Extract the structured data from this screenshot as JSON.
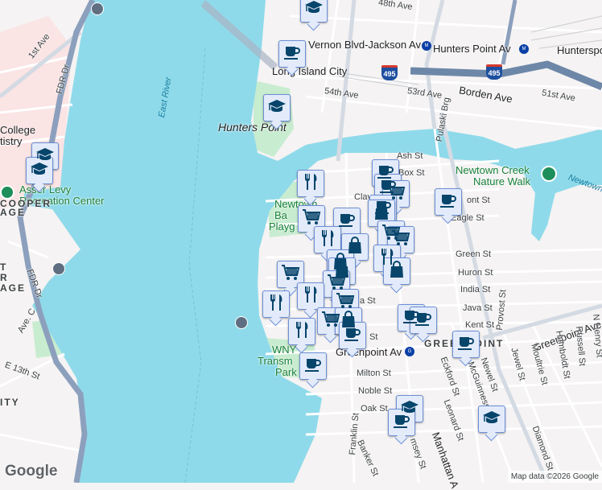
{
  "colors": {
    "water": "#8fdaea",
    "land": "#f5f3f3",
    "park": "#c8ecd0",
    "highway": "#8ca0bd",
    "interstate": "#6d87a8",
    "marker_bg": "#e3ebfb",
    "marker_border": "#6d8fd6",
    "icon": "#07456b"
  },
  "labels": {
    "ave_48th": "48th Ave",
    "vernon": "Vernon Blvd-Jackson Av",
    "hunters_point_av": "Hunters Point Av",
    "hunterspoint": "Hunterspo",
    "lic": "Long Island City",
    "ave_54th": "54th Ave",
    "ave_53rd": "53rd Ave",
    "borden": "Borden Ave",
    "ave_51st": "51st Ave",
    "pulaski": "Pulaski Brg",
    "hunters_point": "Hunters Point",
    "east_river": "East River",
    "ave_1st": "1st Ave",
    "fdr1": "FDR Dr",
    "fdr2": "FDR Dr",
    "college": "College",
    "tistry": "tistry",
    "asser_levy": "Asser Levy",
    "recreation": "Recreation Center",
    "cooper": "COOPER",
    "age1": "AGE",
    "t": "T",
    "r": "R",
    "age2": "AGE",
    "ave_c": "Ave. C",
    "e13": "E 13th St",
    "ity": "ITY",
    "ash": "Ash St",
    "box": "Box St",
    "clay": "Clay",
    "newtown_creek": "Newtown Creek",
    "nature_walk": "Nature Walk",
    "newtown": "Newtown",
    "newtown_b": "Newtown",
    "ba": "Ba",
    "playg": "Playg",
    "dupont": "ont St",
    "eagle": "Eagle St",
    "green": "Green St",
    "huron": "Huron St",
    "india": "India St",
    "java": "Java St",
    "java2": "a St",
    "kent": "Kent St",
    "st": "St",
    "provost": "Provost St",
    "greenpoint_ave": "Greenpoint Ave",
    "greenpoint_av_station": "Greenpoint Av",
    "greenpoint": "GREENPOINT",
    "wny": "WNY",
    "transm": "Transm",
    "park": "Park",
    "milton": "Milton St",
    "noble": "Noble St",
    "oak": "Oak St",
    "franklin": "Franklin St",
    "banker": "Banker St",
    "eckford": "Eckford St",
    "mcguinness": "McGuinness",
    "newel": "Newel St",
    "jewel": "Jewel St",
    "moultrie": "Moultrie St",
    "humboldt": "Humboldt St",
    "russell": "Russell St",
    "n_henry": "N Henry St",
    "leonard": "Leonard St",
    "manhattan": "Manhattan A",
    "diamond": "Diamond St",
    "guernsey": "msey St",
    "i495a": "495",
    "i495b": "495"
  },
  "markers": [
    {
      "type": "school"
    },
    {
      "type": "cafe"
    },
    {
      "type": "school"
    },
    {
      "type": "school"
    },
    {
      "type": "school"
    },
    {
      "type": "restaurant"
    },
    {
      "type": "cafe"
    },
    {
      "type": "cafe"
    },
    {
      "type": "grocery"
    },
    {
      "type": "cafe"
    },
    {
      "type": "grocery"
    },
    {
      "type": "cafe"
    },
    {
      "type": "cafe"
    },
    {
      "type": "shop"
    },
    {
      "type": "grocery"
    },
    {
      "type": "restaurant"
    },
    {
      "type": "shop"
    },
    {
      "type": "grocery"
    },
    {
      "type": "restaurant"
    },
    {
      "type": "shop"
    },
    {
      "type": "shop"
    },
    {
      "type": "shop"
    },
    {
      "type": "grocery"
    },
    {
      "type": "grocery"
    },
    {
      "type": "restaurant"
    },
    {
      "type": "restaurant"
    },
    {
      "type": "grocery"
    },
    {
      "type": "restaurant"
    },
    {
      "type": "grocery"
    },
    {
      "type": "shop"
    },
    {
      "type": "cafe"
    },
    {
      "type": "cafe"
    },
    {
      "type": "cafe"
    },
    {
      "type": "cafe"
    },
    {
      "type": "cafe"
    },
    {
      "type": "school"
    },
    {
      "type": "cafe"
    },
    {
      "type": "school"
    }
  ],
  "branding": {
    "logo": "Google",
    "attribution": "Map data ©2026 Google"
  }
}
